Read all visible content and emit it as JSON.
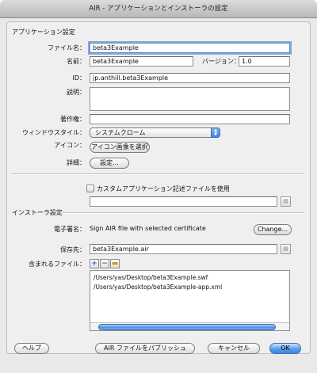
{
  "window": {
    "title": "AIR - アプリケーションとインストーラの設定"
  },
  "app_section": {
    "heading": "アプリケーション設定",
    "file_name": {
      "label": "ファイル名：",
      "value": "beta3Example"
    },
    "name": {
      "label": "名前：",
      "value": "beta3Example"
    },
    "version": {
      "label": "バージョン：",
      "value": "1.0"
    },
    "id": {
      "label": "ID：",
      "value": "jp.anthill.beta3Example"
    },
    "description": {
      "label": "説明：",
      "value": ""
    },
    "copyright": {
      "label": "著作権：",
      "value": ""
    },
    "window_style": {
      "label": "ウィンドウスタイル：",
      "value": "システムクローム"
    },
    "icon": {
      "label": "アイコン：",
      "button": "アイコン画像を選択"
    },
    "advanced": {
      "label": "詳細：",
      "button": "設定..."
    }
  },
  "custom_descriptor": {
    "checkbox_label": "カスタムアプリケーション記述ファイルを使用",
    "checked": false,
    "path": ""
  },
  "installer_section": {
    "heading": "インストーラ設定",
    "signature": {
      "label": "電子署名：",
      "value": "Sign AIR file with selected certificate",
      "button": "Change..."
    },
    "destination": {
      "label": "保存先：",
      "value": "beta3Example.air"
    },
    "included_files": {
      "label": "含まれるファイル：",
      "files": [
        "/Users/yas/Desktop/beta3Example.swf",
        "/Users/yas/Desktop/beta3Example-app.xml"
      ]
    }
  },
  "footer": {
    "help": "ヘルプ",
    "publish": "AIR ファイルをパブリッシュ",
    "cancel": "キャンセル",
    "ok": "OK"
  },
  "colors": {
    "accent": "#3c86e0",
    "focus_ring": "#7fa9dd"
  }
}
